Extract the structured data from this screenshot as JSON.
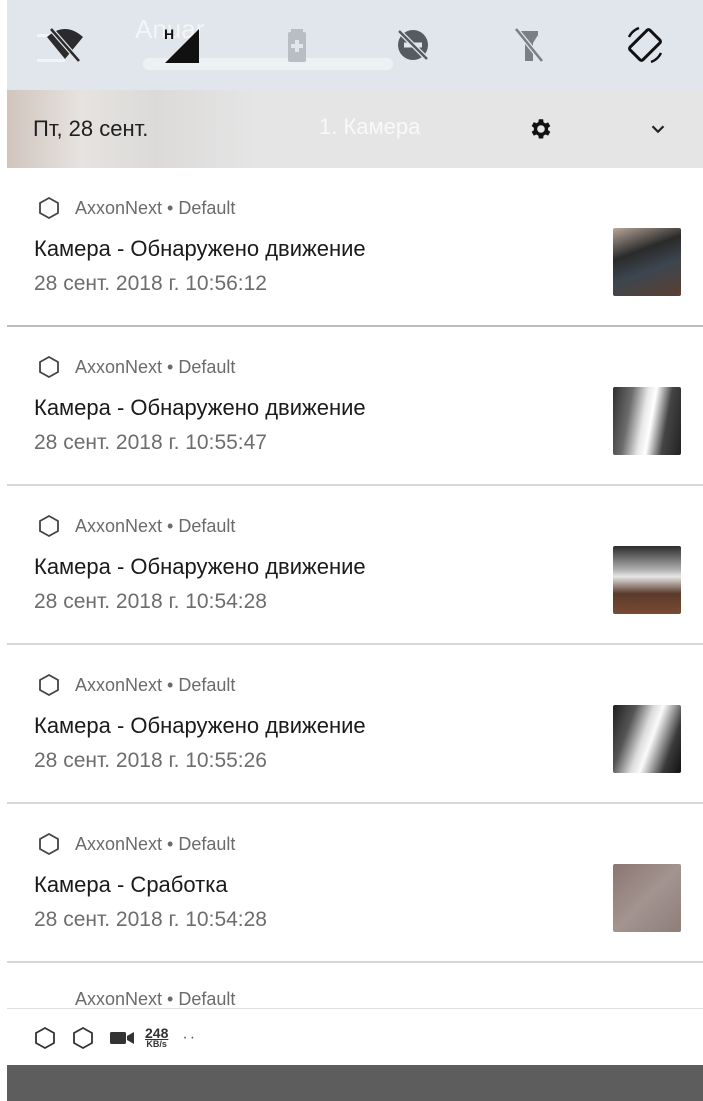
{
  "quick_settings": {
    "background_title": "Anuar",
    "tiles": [
      {
        "icon": "wifi-off-icon"
      },
      {
        "icon": "cellular-h-icon",
        "label": "H"
      },
      {
        "icon": "battery-saver-icon"
      },
      {
        "icon": "do-not-disturb-off-icon"
      },
      {
        "icon": "flashlight-off-icon"
      },
      {
        "icon": "auto-rotate-icon"
      }
    ]
  },
  "header": {
    "date": "Пт, 28 сент.",
    "background_text": "1. Камера",
    "settings_icon": "gear-icon",
    "expand_icon": "chevron-down-icon"
  },
  "notifications": [
    {
      "app": "AxxonNext • Default",
      "title": "Камера - Обнаружено движение",
      "time": "28 сент. 2018 г. 10:56:12"
    },
    {
      "app": "AxxonNext • Default",
      "title": "Камера - Обнаружено движение",
      "time": "28 сент. 2018 г. 10:55:47"
    },
    {
      "app": "AxxonNext • Default",
      "title": "Камера - Обнаружено движение",
      "time": "28 сент. 2018 г. 10:54:28"
    },
    {
      "app": "AxxonNext • Default",
      "title": "Камера - Обнаружено движение",
      "time": "28 сент. 2018 г. 10:55:26"
    },
    {
      "app": "AxxonNext • Default",
      "title": "Камера - Сработка",
      "time": "28 сент. 2018 г. 10:54:28"
    }
  ],
  "partial_notification": {
    "app": "AxxonNext • Default"
  },
  "shelf": {
    "speed_value": "248",
    "speed_unit": "KB/s",
    "more": "··"
  },
  "colors": {
    "quick_settings_bg": "#e1e6ec",
    "header_bg": "#e5e5e5",
    "bottom_bar": "#5d5d5d"
  }
}
